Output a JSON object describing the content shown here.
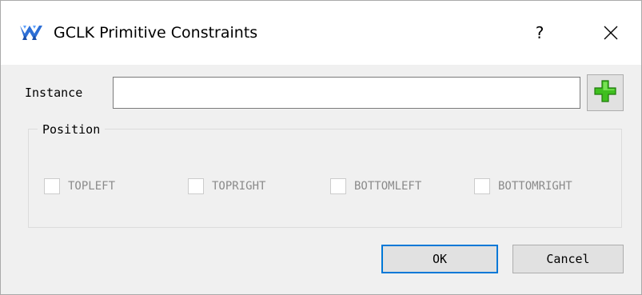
{
  "window": {
    "title": "GCLK Primitive Constraints",
    "help_label": "?",
    "close_icon": "close-icon",
    "app_icon": "gowin-logo-icon"
  },
  "form": {
    "instance_label": "Instance",
    "instance_value": "",
    "instance_placeholder": "",
    "add_icon": "green-plus-icon"
  },
  "position": {
    "legend": "Position",
    "options": [
      {
        "label": "TOPLEFT",
        "checked": false,
        "enabled": false
      },
      {
        "label": "TOPRIGHT",
        "checked": false,
        "enabled": false
      },
      {
        "label": "BOTTOMLEFT",
        "checked": false,
        "enabled": false
      },
      {
        "label": "BOTTOMRIGHT",
        "checked": false,
        "enabled": false
      }
    ]
  },
  "buttons": {
    "ok_label": "OK",
    "cancel_label": "Cancel"
  },
  "colors": {
    "accent": "#0078d7",
    "plus_green": "#3fbf1f",
    "logo_blue": "#2d6fd6"
  }
}
